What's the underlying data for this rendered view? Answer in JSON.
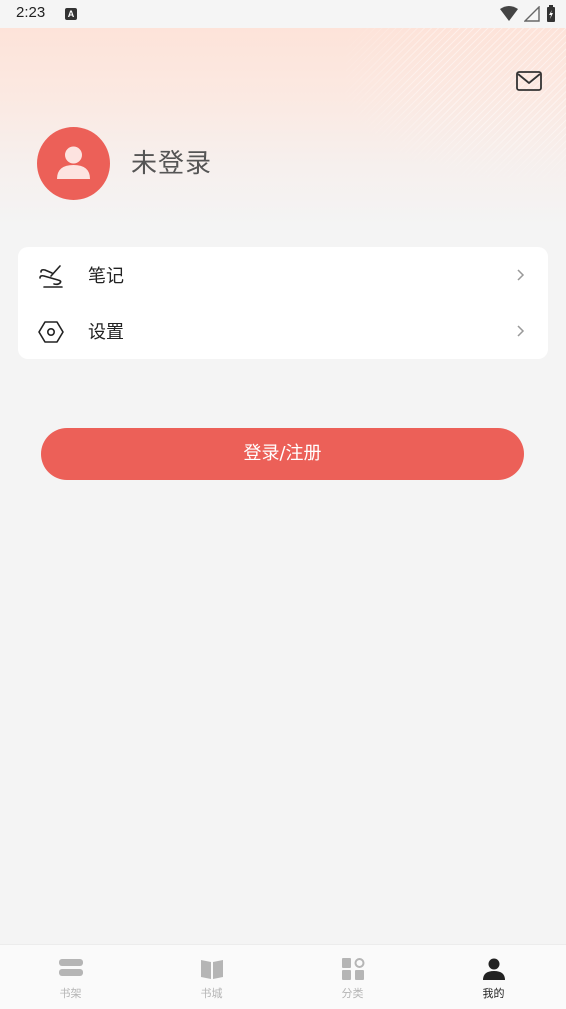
{
  "status_bar": {
    "time": "2:23",
    "indicator": "A"
  },
  "header": {
    "mail_icon": "mail-icon"
  },
  "profile": {
    "name": "未登录",
    "avatar_icon": "person-icon"
  },
  "menu": [
    {
      "label": "笔记",
      "icon": "note-icon"
    },
    {
      "label": "设置",
      "icon": "hexagon-settings-icon"
    }
  ],
  "login_button": {
    "label": "登录/注册"
  },
  "tabbar": {
    "tabs": [
      {
        "label": "书架",
        "icon": "bookshelf-icon"
      },
      {
        "label": "书城",
        "icon": "book-open-icon"
      },
      {
        "label": "分类",
        "icon": "category-grid-icon"
      },
      {
        "label": "我的",
        "icon": "person-icon"
      }
    ],
    "active_index": 3
  },
  "colors": {
    "accent": "#ec6058",
    "inactive": "#b5b5b5",
    "active": "#222222"
  }
}
